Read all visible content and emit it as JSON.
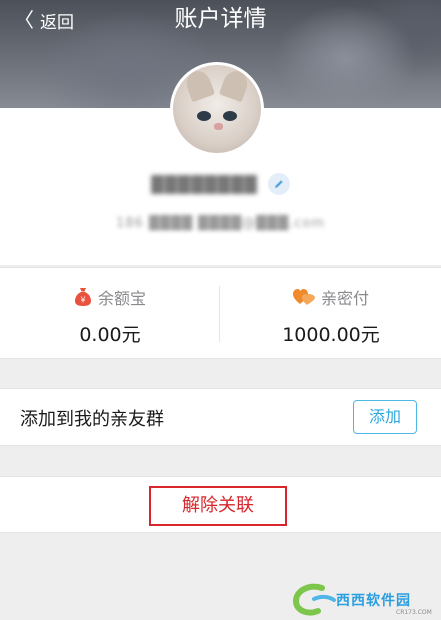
{
  "nav": {
    "back_label": "返回",
    "title": "账户详情"
  },
  "profile": {
    "name": "████████",
    "account": "186 ████ ████@███.com"
  },
  "wallet": {
    "yuebao": {
      "label": "余额宝",
      "value": "0.00元",
      "icon": "moneybag-icon",
      "color": "#e9523c"
    },
    "qinmifu": {
      "label": "亲密付",
      "value": "1000.00元",
      "icon": "hearts-icon",
      "color": "#f08a2a"
    }
  },
  "friends": {
    "label": "添加到我的亲友群",
    "add_button": "添加"
  },
  "unlink": {
    "label": "解除关联"
  },
  "watermark": {
    "text": "西西软件园",
    "sub": "CR173.COM"
  },
  "colors": {
    "accent": "#2ea8e0",
    "danger": "#d8262c"
  }
}
